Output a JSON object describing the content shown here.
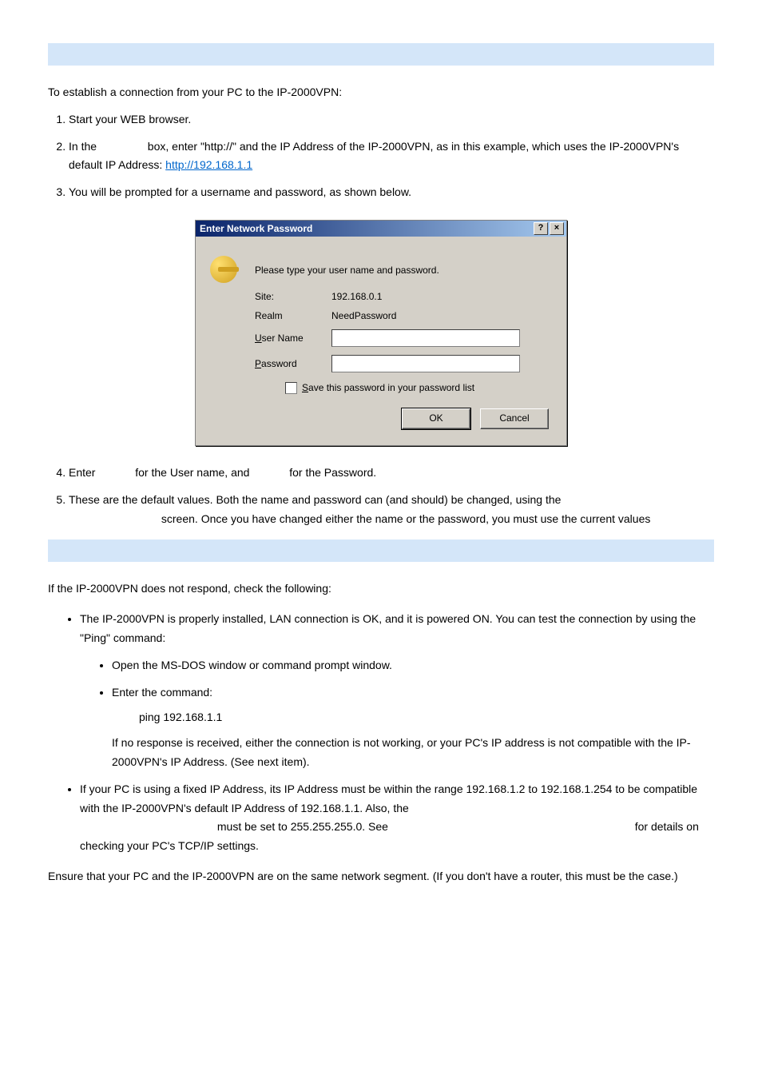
{
  "section1": {
    "intro": "To establish a connection from your PC to the IP-2000VPN:",
    "step1": "Start your WEB browser.",
    "step2_a": "In the ",
    "step2_b": " box, enter \"http://\" and the IP Address of the IP-2000VPN, as in this example, which uses the IP-2000VPN's default IP Address: ",
    "step2_link": "http://192.168.1.1",
    "step3": "You will be prompted for a username and password, as shown below.",
    "step4_a": "Enter ",
    "step4_b": " for the User name, and ",
    "step4_c": " for the Password.",
    "step5_a": "These are the default values. Both the name and password can (and should) be changed, using the ",
    "step5_b": " screen. Once you have changed either the name or the password, you must use the current values"
  },
  "dialog": {
    "title": "Enter Network Password",
    "prompt": "Please type your user name and password.",
    "site_label": "Site:",
    "site_value": "192.168.0.1",
    "realm_label": "Realm",
    "realm_value": "NeedPassword",
    "user_label": "User Name",
    "pass_label": "Password",
    "save_label": "Save this password in your password list",
    "ok": "OK",
    "cancel": "Cancel",
    "help_btn": "?",
    "close_btn": "×"
  },
  "section2": {
    "intro": "If the IP-2000VPN does not respond, check the following:",
    "b1": "The IP-2000VPN is properly installed, LAN connection is OK, and it is powered ON. You can test the connection by using the \"Ping\" command:",
    "s1": "Open the MS-DOS window or command prompt window.",
    "s2": "Enter the command:",
    "ping": "ping 192.168.1.1",
    "s2_tail": "If no response is received, either the connection is not working, or your PC's IP address is not compatible with the IP-2000VPN's IP Address. (See next item).",
    "b2_a": "If your PC is using a fixed IP Address, its IP Address must be within the range 192.168.1.2 to 192.168.1.254 to be compatible with the IP-2000VPN's default IP Address of 192.168.1.1. Also, the ",
    "b2_b": " must be set to 255.255.255.0. See ",
    "b2_c": " for details on checking your PC's TCP/IP settings.",
    "footer": "Ensure that your PC and the IP-2000VPN are on the same network segment. (If you don't have a router, this must be the case.)"
  }
}
